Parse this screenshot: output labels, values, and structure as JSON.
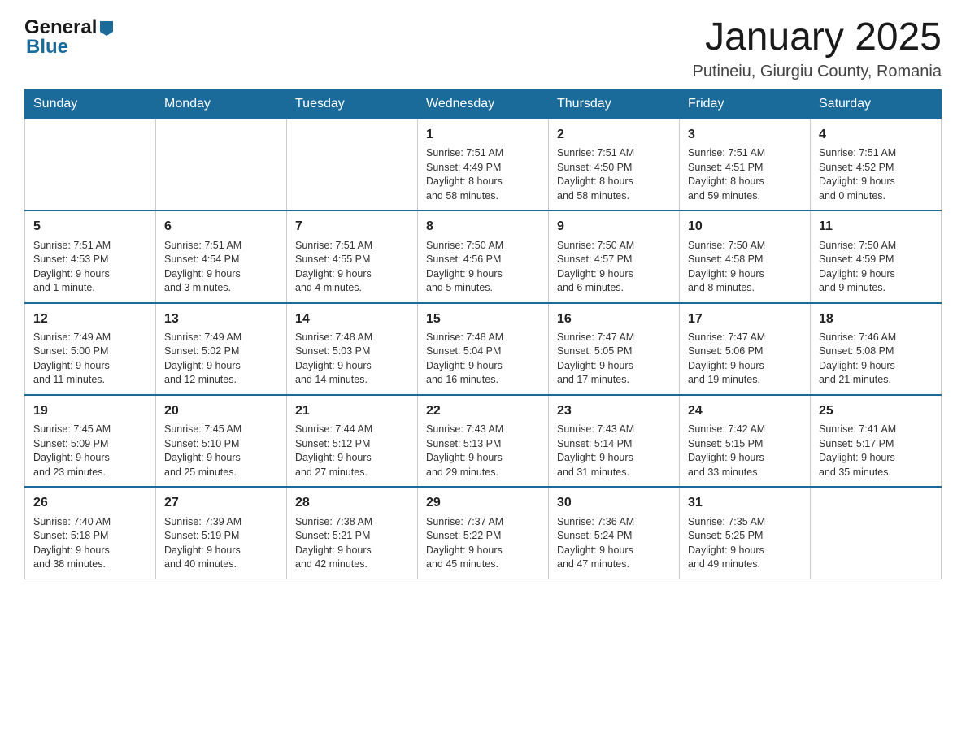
{
  "header": {
    "logo_general": "General",
    "logo_blue": "Blue",
    "month": "January 2025",
    "location": "Putineiu, Giurgiu County, Romania"
  },
  "days_of_week": [
    "Sunday",
    "Monday",
    "Tuesday",
    "Wednesday",
    "Thursday",
    "Friday",
    "Saturday"
  ],
  "weeks": [
    [
      {
        "day": "",
        "info": ""
      },
      {
        "day": "",
        "info": ""
      },
      {
        "day": "",
        "info": ""
      },
      {
        "day": "1",
        "info": "Sunrise: 7:51 AM\nSunset: 4:49 PM\nDaylight: 8 hours\nand 58 minutes."
      },
      {
        "day": "2",
        "info": "Sunrise: 7:51 AM\nSunset: 4:50 PM\nDaylight: 8 hours\nand 58 minutes."
      },
      {
        "day": "3",
        "info": "Sunrise: 7:51 AM\nSunset: 4:51 PM\nDaylight: 8 hours\nand 59 minutes."
      },
      {
        "day": "4",
        "info": "Sunrise: 7:51 AM\nSunset: 4:52 PM\nDaylight: 9 hours\nand 0 minutes."
      }
    ],
    [
      {
        "day": "5",
        "info": "Sunrise: 7:51 AM\nSunset: 4:53 PM\nDaylight: 9 hours\nand 1 minute."
      },
      {
        "day": "6",
        "info": "Sunrise: 7:51 AM\nSunset: 4:54 PM\nDaylight: 9 hours\nand 3 minutes."
      },
      {
        "day": "7",
        "info": "Sunrise: 7:51 AM\nSunset: 4:55 PM\nDaylight: 9 hours\nand 4 minutes."
      },
      {
        "day": "8",
        "info": "Sunrise: 7:50 AM\nSunset: 4:56 PM\nDaylight: 9 hours\nand 5 minutes."
      },
      {
        "day": "9",
        "info": "Sunrise: 7:50 AM\nSunset: 4:57 PM\nDaylight: 9 hours\nand 6 minutes."
      },
      {
        "day": "10",
        "info": "Sunrise: 7:50 AM\nSunset: 4:58 PM\nDaylight: 9 hours\nand 8 minutes."
      },
      {
        "day": "11",
        "info": "Sunrise: 7:50 AM\nSunset: 4:59 PM\nDaylight: 9 hours\nand 9 minutes."
      }
    ],
    [
      {
        "day": "12",
        "info": "Sunrise: 7:49 AM\nSunset: 5:00 PM\nDaylight: 9 hours\nand 11 minutes."
      },
      {
        "day": "13",
        "info": "Sunrise: 7:49 AM\nSunset: 5:02 PM\nDaylight: 9 hours\nand 12 minutes."
      },
      {
        "day": "14",
        "info": "Sunrise: 7:48 AM\nSunset: 5:03 PM\nDaylight: 9 hours\nand 14 minutes."
      },
      {
        "day": "15",
        "info": "Sunrise: 7:48 AM\nSunset: 5:04 PM\nDaylight: 9 hours\nand 16 minutes."
      },
      {
        "day": "16",
        "info": "Sunrise: 7:47 AM\nSunset: 5:05 PM\nDaylight: 9 hours\nand 17 minutes."
      },
      {
        "day": "17",
        "info": "Sunrise: 7:47 AM\nSunset: 5:06 PM\nDaylight: 9 hours\nand 19 minutes."
      },
      {
        "day": "18",
        "info": "Sunrise: 7:46 AM\nSunset: 5:08 PM\nDaylight: 9 hours\nand 21 minutes."
      }
    ],
    [
      {
        "day": "19",
        "info": "Sunrise: 7:45 AM\nSunset: 5:09 PM\nDaylight: 9 hours\nand 23 minutes."
      },
      {
        "day": "20",
        "info": "Sunrise: 7:45 AM\nSunset: 5:10 PM\nDaylight: 9 hours\nand 25 minutes."
      },
      {
        "day": "21",
        "info": "Sunrise: 7:44 AM\nSunset: 5:12 PM\nDaylight: 9 hours\nand 27 minutes."
      },
      {
        "day": "22",
        "info": "Sunrise: 7:43 AM\nSunset: 5:13 PM\nDaylight: 9 hours\nand 29 minutes."
      },
      {
        "day": "23",
        "info": "Sunrise: 7:43 AM\nSunset: 5:14 PM\nDaylight: 9 hours\nand 31 minutes."
      },
      {
        "day": "24",
        "info": "Sunrise: 7:42 AM\nSunset: 5:15 PM\nDaylight: 9 hours\nand 33 minutes."
      },
      {
        "day": "25",
        "info": "Sunrise: 7:41 AM\nSunset: 5:17 PM\nDaylight: 9 hours\nand 35 minutes."
      }
    ],
    [
      {
        "day": "26",
        "info": "Sunrise: 7:40 AM\nSunset: 5:18 PM\nDaylight: 9 hours\nand 38 minutes."
      },
      {
        "day": "27",
        "info": "Sunrise: 7:39 AM\nSunset: 5:19 PM\nDaylight: 9 hours\nand 40 minutes."
      },
      {
        "day": "28",
        "info": "Sunrise: 7:38 AM\nSunset: 5:21 PM\nDaylight: 9 hours\nand 42 minutes."
      },
      {
        "day": "29",
        "info": "Sunrise: 7:37 AM\nSunset: 5:22 PM\nDaylight: 9 hours\nand 45 minutes."
      },
      {
        "day": "30",
        "info": "Sunrise: 7:36 AM\nSunset: 5:24 PM\nDaylight: 9 hours\nand 47 minutes."
      },
      {
        "day": "31",
        "info": "Sunrise: 7:35 AM\nSunset: 5:25 PM\nDaylight: 9 hours\nand 49 minutes."
      },
      {
        "day": "",
        "info": ""
      }
    ]
  ]
}
